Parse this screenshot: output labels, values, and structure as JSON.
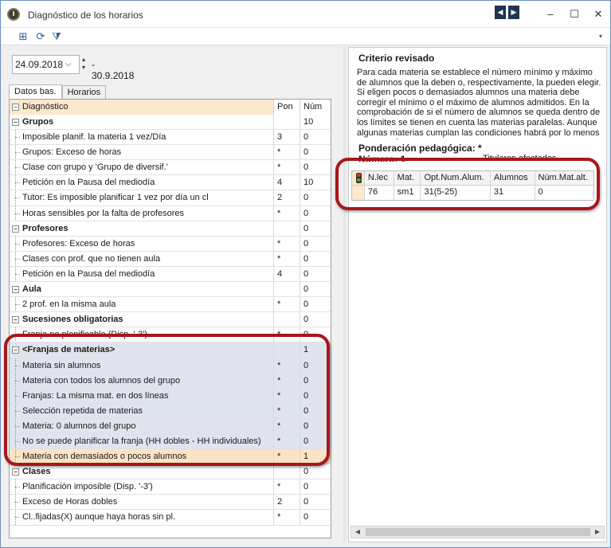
{
  "window": {
    "title": "Diagnóstico de los horarios",
    "minimize": "–",
    "maximize": "☐",
    "close": "✕",
    "prev": "◀",
    "next": "▶"
  },
  "toolbar": {
    "icons": [
      "grid-icon",
      "refresh-icon",
      "filter-icon"
    ],
    "more": "▾"
  },
  "date": {
    "start": "24.09.2018",
    "end": "- 30.9.2018"
  },
  "tabs": [
    "Datos bas.",
    "Horarios"
  ],
  "grid": {
    "headers": {
      "diag": "Diagnóstico",
      "pon": "Pon",
      "num": "Núm"
    },
    "rows": [
      {
        "type": "group",
        "label": "Grupos",
        "pon": "",
        "num": "10"
      },
      {
        "type": "child",
        "label": "Imposible planif. la materia 1 vez/Día",
        "pon": "3",
        "num": "0"
      },
      {
        "type": "child",
        "label": "Grupos: Exceso de horas",
        "pon": "*",
        "num": "0"
      },
      {
        "type": "child",
        "label": "Clase con grupo y 'Grupo de diversif.'",
        "pon": "*",
        "num": "0"
      },
      {
        "type": "child",
        "label": "Petición en la Pausa del mediodía",
        "pon": "4",
        "num": "10"
      },
      {
        "type": "child",
        "label": "Tutor: Es imposible planificar 1 vez por día un cl",
        "pon": "2",
        "num": "0"
      },
      {
        "type": "child",
        "label": "Horas sensibles por la falta de profesores",
        "pon": "*",
        "num": "0"
      },
      {
        "type": "group",
        "label": "Profesores",
        "pon": "",
        "num": "0"
      },
      {
        "type": "child",
        "label": "Profesores: Exceso de horas",
        "pon": "*",
        "num": "0"
      },
      {
        "type": "child",
        "label": "Clases con prof. que no tienen aula",
        "pon": "*",
        "num": "0"
      },
      {
        "type": "child",
        "label": "Petición en la Pausa del mediodía",
        "pon": "4",
        "num": "0"
      },
      {
        "type": "group",
        "label": "Aula",
        "pon": "",
        "num": "0"
      },
      {
        "type": "child",
        "label": "2 prof. en la misma aula",
        "pon": "*",
        "num": "0"
      },
      {
        "type": "group",
        "label": "Sucesiones obligatorias",
        "pon": "",
        "num": "0"
      },
      {
        "type": "child",
        "label": "Franja no planificable (Disp. '-3')",
        "pon": "*",
        "num": "0"
      },
      {
        "type": "group shaded",
        "label": "<Franjas de materias>",
        "pon": "",
        "num": "1"
      },
      {
        "type": "child shaded",
        "label": "Materia sin alumnos",
        "pon": "*",
        "num": "0"
      },
      {
        "type": "child shaded",
        "label": "Materia con todos los alumnos del grupo",
        "pon": "*",
        "num": "0"
      },
      {
        "type": "child shaded",
        "label": "Franjas: La  misma mat. en dos líneas",
        "pon": "*",
        "num": "0"
      },
      {
        "type": "child shaded",
        "label": "Selección repetida de materias",
        "pon": "*",
        "num": "0"
      },
      {
        "type": "child shaded",
        "label": "Materia: 0 alumnos del grupo",
        "pon": "*",
        "num": "0"
      },
      {
        "type": "child shaded",
        "label": "No se puede planificar la franja (HH dobles - HH individuales)",
        "pon": "*",
        "num": "0"
      },
      {
        "type": "child selected",
        "label": "Materia con demasiados o pocos alumnos",
        "pon": "*",
        "num": "1"
      },
      {
        "type": "group",
        "label": "Clases",
        "pon": "",
        "num": "0"
      },
      {
        "type": "child",
        "label": "Planificación imposible (Disp. '-3')",
        "pon": "*",
        "num": "0"
      },
      {
        "type": "child",
        "label": "Exceso de Horas dobles",
        "pon": "2",
        "num": "0"
      },
      {
        "type": "child",
        "label": "Cl..fijadas(X) aunque haya horas sin pl.",
        "pon": "*",
        "num": "0"
      }
    ]
  },
  "criterio": {
    "title": "Criterio revisado",
    "text": "Para cada materia se establece el número mínimo y máximo de alumnos que la deben o, respectivamente, la pueden elegir. Si eligen pocos o demasiados alumnos una materia debe corregir el mínimo o el máximo de alumnos admitidos. En la comprobación de si el número de alumnos se queda dentro de los límites se tienen en cuenta las materias paralelas. Aunque algunas materias cumplan las condiciones habrá por lo menos una materia",
    "ponderacion": "Ponderación pedagógica: *",
    "numero": "Número: 1",
    "titulares": "Titulares afectados"
  },
  "detail": {
    "headers": [
      "N.lec",
      "Mat.",
      "Opt.Num.Alum.",
      "Alumnos",
      "Núm.Mat.alt."
    ],
    "row": [
      "76",
      "sm1",
      "31(5-25)",
      "31",
      "0"
    ]
  },
  "scroll": {
    "left": "◀",
    "right": "▶"
  },
  "colors": {
    "highlight": "#a8161b",
    "selected_row": "#fbe3c5",
    "shaded_row": "#dfe4ee"
  }
}
